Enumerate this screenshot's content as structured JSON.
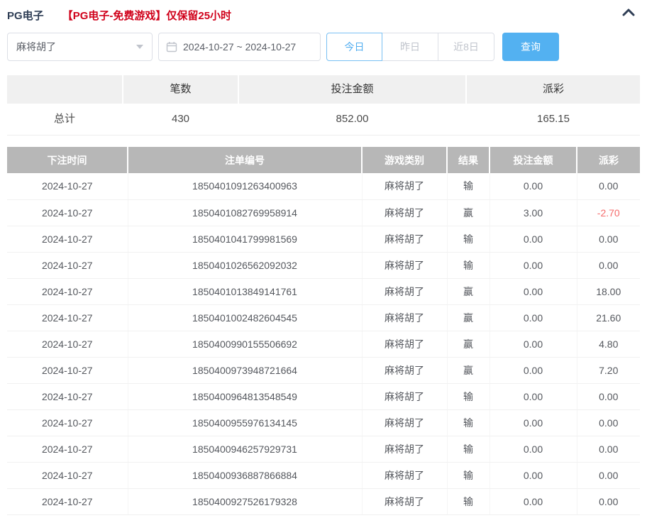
{
  "header": {
    "title": "PG电子",
    "notice": "【PG电子-免费游戏】仅保留25小时"
  },
  "filters": {
    "game_select": {
      "value": "麻将胡了"
    },
    "date_range": {
      "value": "2024-10-27 ~ 2024-10-27"
    },
    "quick_buttons": [
      {
        "label": "今日",
        "active": true
      },
      {
        "label": "昨日",
        "active": false
      },
      {
        "label": "近8日",
        "active": false
      }
    ],
    "search_button": "查询"
  },
  "summary": {
    "columns": [
      "",
      "笔数",
      "投注金额",
      "派彩"
    ],
    "total_label": "总计",
    "count": "430",
    "bet_amount": "852.00",
    "payout": "165.15"
  },
  "records": {
    "columns": [
      "下注时间",
      "注单编号",
      "游戏类别",
      "结果",
      "投注金额",
      "派彩"
    ],
    "rows": [
      [
        "2024-10-27",
        "1850401091263400963",
        "麻将胡了",
        "输",
        "0.00",
        "0.00"
      ],
      [
        "2024-10-27",
        "1850401082769958914",
        "麻将胡了",
        "赢",
        "3.00",
        "-2.70"
      ],
      [
        "2024-10-27",
        "1850401041799981569",
        "麻将胡了",
        "输",
        "0.00",
        "0.00"
      ],
      [
        "2024-10-27",
        "1850401026562092032",
        "麻将胡了",
        "输",
        "0.00",
        "0.00"
      ],
      [
        "2024-10-27",
        "1850401013849141761",
        "麻将胡了",
        "赢",
        "0.00",
        "18.00"
      ],
      [
        "2024-10-27",
        "1850401002482604545",
        "麻将胡了",
        "赢",
        "0.00",
        "21.60"
      ],
      [
        "2024-10-27",
        "1850400990155506692",
        "麻将胡了",
        "赢",
        "0.00",
        "4.80"
      ],
      [
        "2024-10-27",
        "1850400973948721664",
        "麻将胡了",
        "赢",
        "0.00",
        "7.20"
      ],
      [
        "2024-10-27",
        "1850400964813548549",
        "麻将胡了",
        "输",
        "0.00",
        "0.00"
      ],
      [
        "2024-10-27",
        "1850400955976134145",
        "麻将胡了",
        "输",
        "0.00",
        "0.00"
      ],
      [
        "2024-10-27",
        "1850400946257929731",
        "麻将胡了",
        "输",
        "0.00",
        "0.00"
      ],
      [
        "2024-10-27",
        "1850400936887866884",
        "麻将胡了",
        "输",
        "0.00",
        "0.00"
      ],
      [
        "2024-10-27",
        "1850400927526179328",
        "麻将胡了",
        "输",
        "0.00",
        "0.00"
      ]
    ]
  },
  "colors": {
    "accent_blue": "#53b1f1",
    "title_navy": "#2f3e55",
    "notice_red": "#d0021b",
    "negative_red": "#f56c6c",
    "table_header_gray": "#b7b7b7"
  }
}
